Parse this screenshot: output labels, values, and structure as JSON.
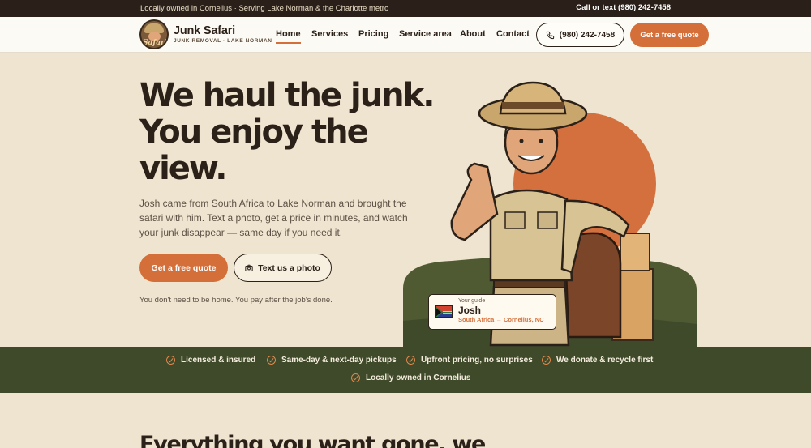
{
  "topbar": {
    "left_text": "Locally owned in Cornelius · Serving Lake Norman & the Charlotte metro",
    "right_text": "Call or text (980) 242-7458"
  },
  "brand": {
    "logo_word": "Safari",
    "name": "Junk Safari",
    "tagline": "JUNK REMOVAL · LAKE NORMAN"
  },
  "nav": {
    "links": [
      "Home",
      "Services",
      "Pricing",
      "Service area",
      "About",
      "Contact"
    ],
    "active": "Home",
    "phone_button": "(980) 242-7458",
    "quote_button": "Get a free quote"
  },
  "hero": {
    "title_lines": [
      "We haul the junk.",
      "You enjoy the",
      "view."
    ],
    "copy": "Josh came from South Africa to Lake Norman and brought the safari with him. Text a photo, get a price in minutes, and watch your junk disappear — same day if you need it.",
    "primary_button": "Get a free quote",
    "secondary_button": "Text us a photo",
    "note": "You don't need to be home. You pay after the job's done."
  },
  "guide": {
    "label": "Your guide",
    "name": "Josh",
    "route": "South Africa → Cornelius, NC"
  },
  "trust": {
    "items": [
      "Licensed & insured",
      "Same-day & next-day pickups",
      "Upfront pricing, no surprises",
      "We donate & recycle first",
      "Locally owned in Cornelius"
    ]
  },
  "next_section": {
    "title_partial": "Everything you want gone, we"
  },
  "colors": {
    "accent": "#d46f3a",
    "dark": "#2b2118",
    "olive": "#3f4a2b",
    "cream": "#efe4cf"
  }
}
